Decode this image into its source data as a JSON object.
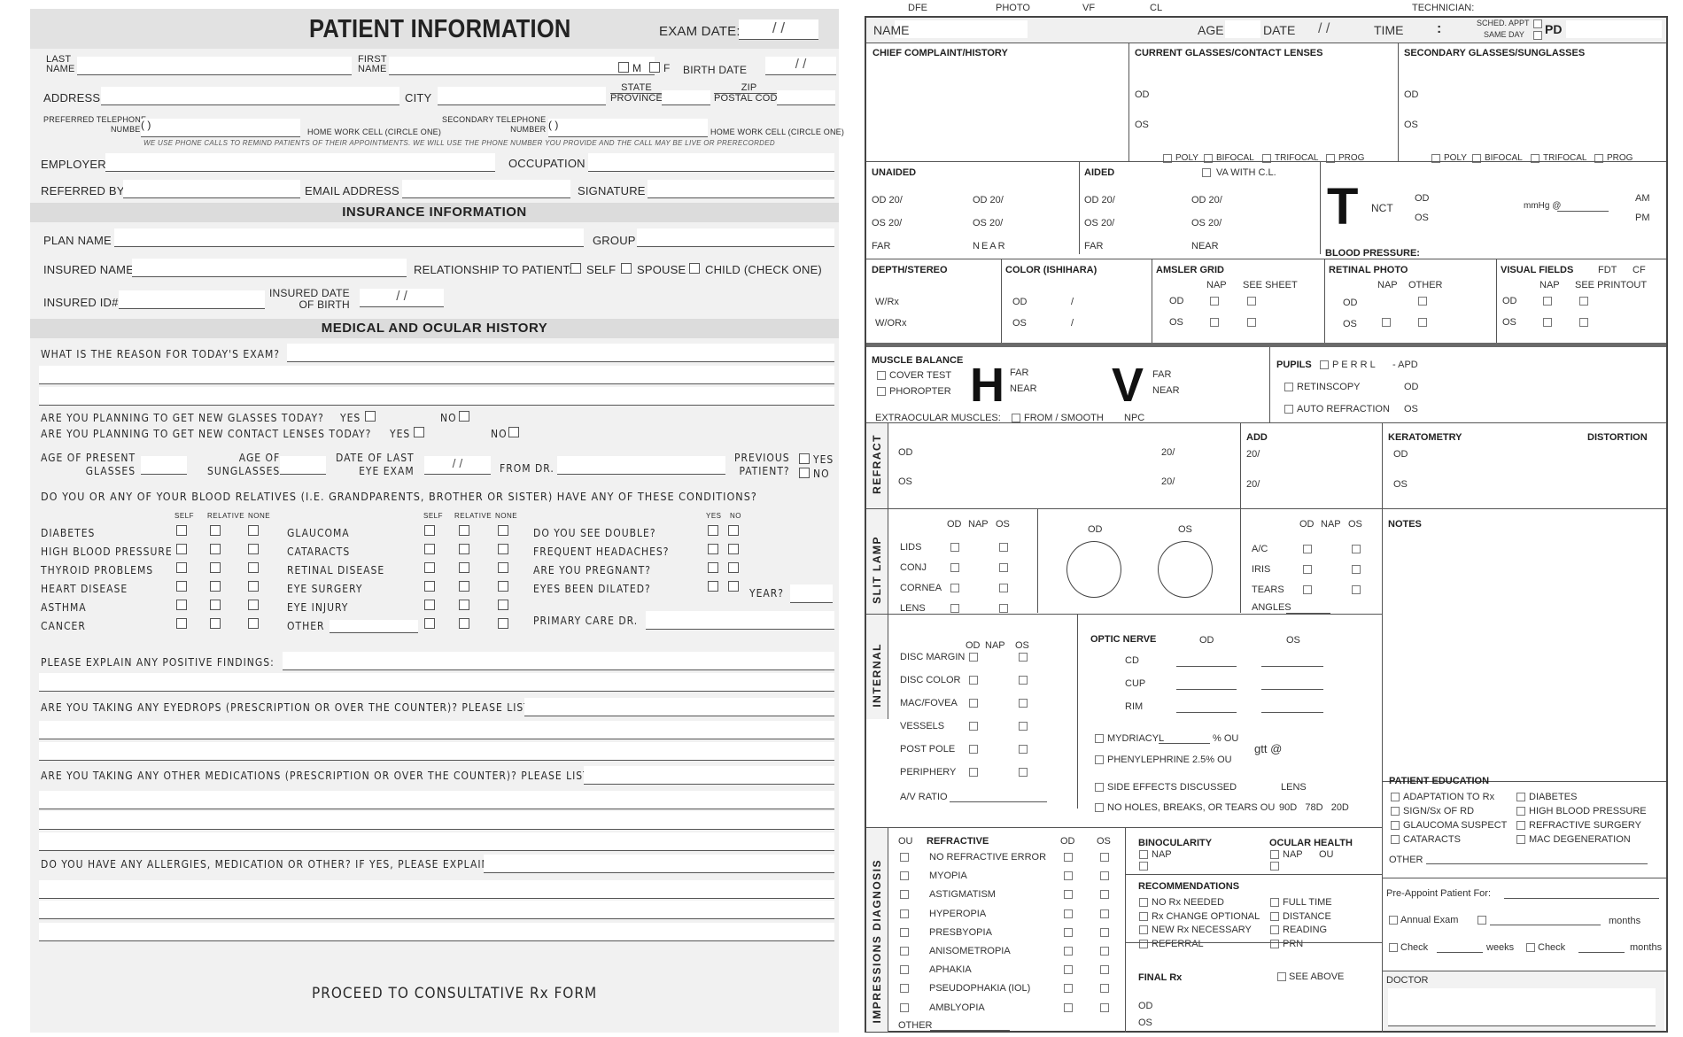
{
  "left": {
    "title": "PATIENT INFORMATION",
    "exam_date_label": "EXAM DATE:",
    "date_slashes": "/ /",
    "last_name": [
      "LAST",
      "NAME"
    ],
    "first_name": [
      "FIRST",
      "NAME"
    ],
    "sex_m": "M",
    "sex_f": "F",
    "birth_date": "BIRTH DATE",
    "address": "ADDRESS",
    "city": "CITY",
    "state": [
      "STATE",
      "PROVINCE"
    ],
    "zip": [
      "ZIP",
      "POSTAL CODE"
    ],
    "pref_phone": [
      "PREFERRED TELEPHONE",
      "NUMBER"
    ],
    "phone_paren": "(       )",
    "circle_one": "HOME WORK CELL (CIRCLE ONE)",
    "sec_phone": [
      "SECONDARY TELEPHONE",
      "NUMBER"
    ],
    "phone_notice": "WE USE PHONE CALLS TO REMIND PATIENTS OF THEIR APPOINTMENTS. WE WILL USE THE PHONE NUMBER YOU PROVIDE AND THE CALL MAY BE LIVE OR PRERECORDED",
    "employer": "EMPLOYER",
    "occupation": "OCCUPATION",
    "referred_by": "REFERRED BY",
    "email": "EMAIL ADDRESS",
    "signature": "SIGNATURE",
    "insurance_header": "INSURANCE INFORMATION",
    "plan_name": "PLAN NAME",
    "group": "GROUP",
    "insured_name": "INSURED NAME",
    "relationship": "RELATIONSHIP TO PATIENT:",
    "rel_self": "SELF",
    "rel_spouse": "SPOUSE",
    "rel_child": "CHILD (CHECK ONE)",
    "insured_id": "INSURED ID#",
    "insured_dob": [
      "INSURED DATE",
      "OF BIRTH"
    ],
    "history_header": "MEDICAL AND OCULAR HISTORY",
    "reason": "WHAT IS THE REASON FOR TODAY'S EXAM?",
    "q_glasses": "ARE YOU PLANNING TO GET NEW GLASSES TODAY?",
    "q_contacts": "ARE YOU PLANNING TO GET NEW CONTACT LENSES TODAY?",
    "yes": "YES",
    "no": "NO",
    "age_glasses": [
      "AGE OF PRESENT",
      "GLASSES"
    ],
    "age_sunglasses": [
      "AGE OF",
      "SUNGLASSES"
    ],
    "last_exam": [
      "DATE OF LAST",
      "EYE EXAM"
    ],
    "from_dr": "FROM DR.",
    "previous_patient": [
      "PREVIOUS",
      "PATIENT?"
    ],
    "relatives_q": "DO YOU OR ANY OF YOUR BLOOD RELATIVES (I.E. GRANDPARENTS, BROTHER OR SISTER) HAVE ANY OF THESE CONDITIONS?",
    "cond_headers": [
      "SELF",
      "RELATIVE",
      "NONE"
    ],
    "yn_headers": [
      "YES",
      "NO"
    ],
    "conditions_col1": [
      "DIABETES",
      "HIGH BLOOD PRESSURE",
      "THYROID PROBLEMS",
      "HEART DISEASE",
      "ASTHMA",
      "CANCER"
    ],
    "conditions_col2": [
      "GLAUCOMA",
      "CATARACTS",
      "RETINAL DISEASE",
      "EYE SURGERY",
      "EYE INJURY",
      "OTHER"
    ],
    "yn_questions": [
      "DO YOU SEE DOUBLE?",
      "FREQUENT HEADACHES?",
      "ARE YOU PREGNANT?",
      "EYES BEEN DILATED?"
    ],
    "year": "YEAR?",
    "primary_care": "PRIMARY CARE DR.",
    "positive_findings": "PLEASE EXPLAIN ANY POSITIVE FINDINGS:",
    "eyedrops": "ARE YOU TAKING ANY EYEDROPS (PRESCRIPTION OR OVER THE COUNTER)?  PLEASE LIST.",
    "medications": "ARE YOU TAKING ANY OTHER MEDICATIONS (PRESCRIPTION OR OVER THE COUNTER)?  PLEASE LIST.",
    "allergies": "DO YOU HAVE ANY ALLERGIES, MEDICATION OR OTHER? IF YES, PLEASE EXPLAIN.",
    "proceed": "PROCEED TO CONSULTATIVE Rx FORM"
  },
  "right": {
    "top_labels": [
      "DFE",
      "PHOTO",
      "VF",
      "CL"
    ],
    "technician": "TECHNICIAN:",
    "name": "NAME",
    "age": "AGE",
    "date": "DATE",
    "date_slashes": "/     /",
    "time": "TIME",
    "colon": ":",
    "sched_appt": "SCHED. APPT",
    "same_day": "SAME DAY",
    "pd": "PD",
    "chief_complaint": "CHIEF COMPLAINT/HISTORY",
    "current_glasses": "CURRENT GLASSES/CONTACT LENSES",
    "secondary_glasses": "SECONDARY GLASSES/SUNGLASSES",
    "od": "OD",
    "os": "OS",
    "ou": "OU",
    "lens_types": [
      "POLY",
      "BIFOCAL",
      "TRIFOCAL",
      "PROG"
    ],
    "unaided": "UNAIDED",
    "aided": "AIDED",
    "va_with_cl": "VA WITH C.L.",
    "od20": "OD 20/",
    "os20": "OS 20/",
    "far": "FAR",
    "near": "NEAR",
    "t_letter": "T",
    "nct": "NCT",
    "mmhg": "mmHg @",
    "am": "AM",
    "pm": "PM",
    "blood_pressure": "BLOOD PRESSURE:",
    "depth_stereo": "DEPTH/STEREO",
    "wrx": "W/Rx",
    "worx": "W/ORx",
    "color": "COLOR (ISHIHARA)",
    "slash": "/",
    "amsler": "AMSLER GRID",
    "nap": "NAP",
    "see_sheet": "SEE SHEET",
    "retinal_photo": "RETINAL PHOTO",
    "other": "OTHER",
    "visual_fields": "VISUAL FIELDS",
    "fdt": "FDT",
    "cf": "CF",
    "see_printout": "SEE PRINTOUT",
    "muscle_balance": "MUSCLE BALANCE",
    "cover_test": "COVER TEST",
    "phoropter": "PHOROPTER",
    "h_letter": "H",
    "v_letter": "V",
    "extraocular": "EXTRAOCULAR MUSCLES:",
    "from_smooth": "FROM / SMOOTH",
    "npc": "NPC",
    "pupils": "PUPILS",
    "perrl": "P E R R L",
    "apd": "- APD",
    "retinoscopy": "RETINSCOPY",
    "auto_refraction": "AUTO REFRACTION",
    "refract": "REFRACT",
    "twenty": "20/",
    "add": "ADD",
    "keratometry": "KERATOMETRY",
    "distortion": "DISTORTION",
    "slit_lamp": "SLIT LAMP",
    "slit_items": [
      "LIDS",
      "CONJ",
      "CORNEA",
      "LENS"
    ],
    "slit_items2": [
      "A/C",
      "IRIS",
      "TEARS"
    ],
    "angles": "ANGLES",
    "notes": "NOTES",
    "internal": "INTERNAL",
    "internal_items": [
      "DISC MARGIN",
      "DISC COLOR",
      "MAC/FOVEA",
      "VESSELS",
      "POST POLE",
      "PERIPHERY"
    ],
    "av_ratio": "A/V RATIO",
    "optic_nerve": "OPTIC NERVE",
    "optic_items": [
      "CD",
      "CUP",
      "RIM"
    ],
    "mydriacyl": "MYDRIACYL",
    "pct_ou": "% OU",
    "phenylephrine": "PHENYLEPHRINE 2.5% OU",
    "gtt": "gtt @",
    "side_effects": "SIDE EFFECTS DISCUSSED",
    "no_holes": "NO HOLES, BREAKS, OR TEARS OU",
    "lens": "LENS",
    "lens_powers": "90D   78D   20D",
    "patient_education": "PATIENT EDUCATION",
    "education_col1": [
      "ADAPTATION TO Rx",
      "SIGN/Sx OF RD",
      "GLAUCOMA SUSPECT",
      "CATARACTS"
    ],
    "education_col2": [
      "DIABETES",
      "HIGH BLOOD PRESSURE",
      "REFRACTIVE SURGERY",
      "MAC DEGENERATION"
    ],
    "impressions": "IMPRESSIONS DIAGNOSIS",
    "refractive": "REFRACTIVE",
    "refractive_items": [
      "NO REFRACTIVE ERROR",
      "MYOPIA",
      "ASTIGMATISM",
      "HYPEROPIA",
      "PRESBYOPIA",
      "ANISOMETROPIA",
      "APHAKIA",
      "PSEUDOPHAKIA (IOL)",
      "AMBLYOPIA"
    ],
    "binocularity": "BINOCULARITY",
    "ocular_health": "OCULAR HEALTH",
    "recommendations": "RECOMMENDATIONS",
    "rec_col1": [
      "NO Rx NEEDED",
      "Rx CHANGE OPTIONAL",
      "NEW Rx NECESSARY",
      "REFERRAL"
    ],
    "rec_col2": [
      "FULL TIME",
      "DISTANCE",
      "READING",
      "PRN"
    ],
    "final_rx": "FINAL Rx",
    "see_above": "SEE ABOVE",
    "pre_appoint": "Pre-Appoint Patient For:",
    "annual_exam": "Annual Exam",
    "months": "months",
    "check": "Check",
    "weeks": "weeks",
    "doctor": "DOCTOR"
  }
}
